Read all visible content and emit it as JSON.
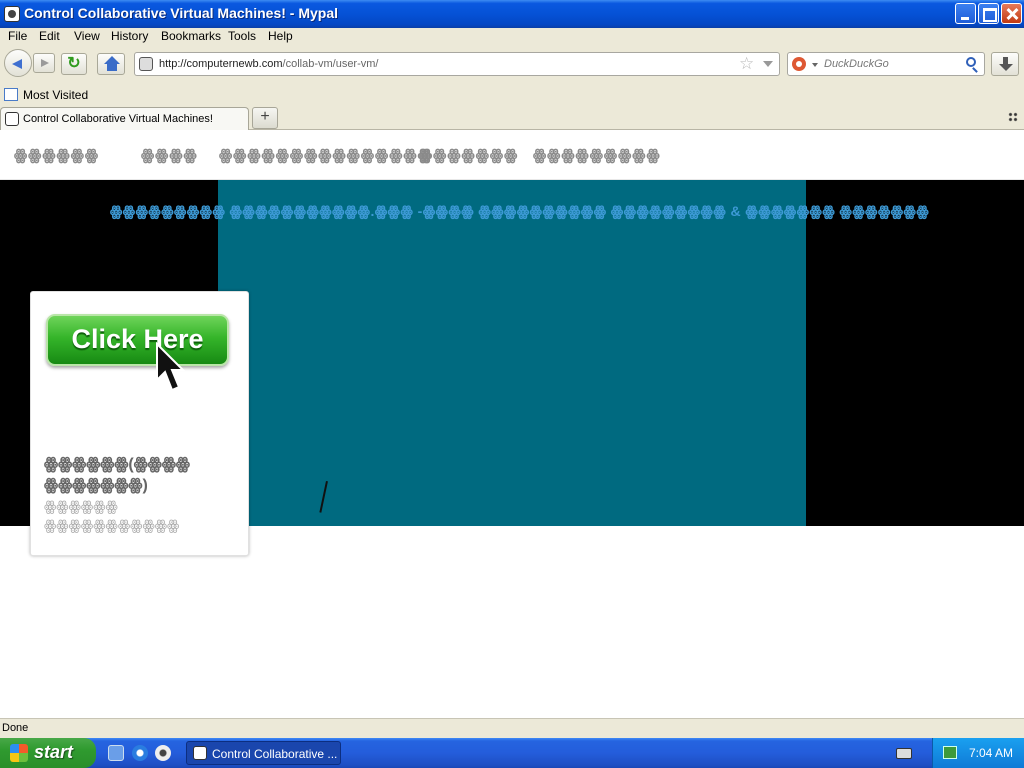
{
  "window": {
    "title": "Control Collaborative Virtual Machines! - Mypal"
  },
  "menubar": {
    "items": [
      "File",
      "Edit",
      "View",
      "History",
      "Bookmarks",
      "Tools",
      "Help"
    ]
  },
  "navbar": {
    "reload_icon": "reload-icon",
    "url_host": "http://computernewb.com",
    "url_path": "/collab-vm/user-vm/",
    "search_placeholder": "DuckDuckGo"
  },
  "bookmarks": {
    "items": [
      "Most Visited"
    ]
  },
  "tabs": {
    "active_label": "Control Collaborative Virtual Machines!",
    "new_tab_label": "+"
  },
  "page": {
    "nav_links": [
      "ꙮꙮꙮꙮꙮꙮ",
      "ꙮꙮꙮꙮ",
      "ꙮꙮꙮꙮꙮꙮꙮꙮꙮꙮꙮꙮꙮꙮꙮ",
      "ꙮꙮꙮꙮꙮꙮꙮ",
      "ꙮꙮꙮꙮꙮꙮꙮꙮꙮ"
    ],
    "banner": "ꙮꙮꙮꙮꙮꙮꙮꙮꙮ ꙮꙮꙮꙮꙮꙮꙮꙮꙮꙮꙮ.ꙮꙮꙮ -ꙮꙮꙮꙮ ꙮꙮꙮꙮꙮꙮꙮꙮꙮꙮ ꙮꙮꙮꙮꙮꙮꙮꙮꙮ & ꙮꙮꙮꙮꙮꙮꙮ ꙮꙮꙮꙮꙮꙮꙮ",
    "cta_label": "Click Here",
    "card_title": "ꙮꙮꙮꙮꙮꙮ(ꙮꙮꙮꙮ ꙮꙮꙮꙮꙮꙮꙮ)",
    "card_subtitle": "ꙮꙮꙮꙮꙮꙮ ꙮꙮꙮꙮꙮꙮꙮꙮꙮꙮꙮ"
  },
  "status": {
    "text": "Done"
  },
  "taskbar": {
    "start_label": "start",
    "task_label": "Control Collaborative ...",
    "clock": "7:04 AM"
  }
}
